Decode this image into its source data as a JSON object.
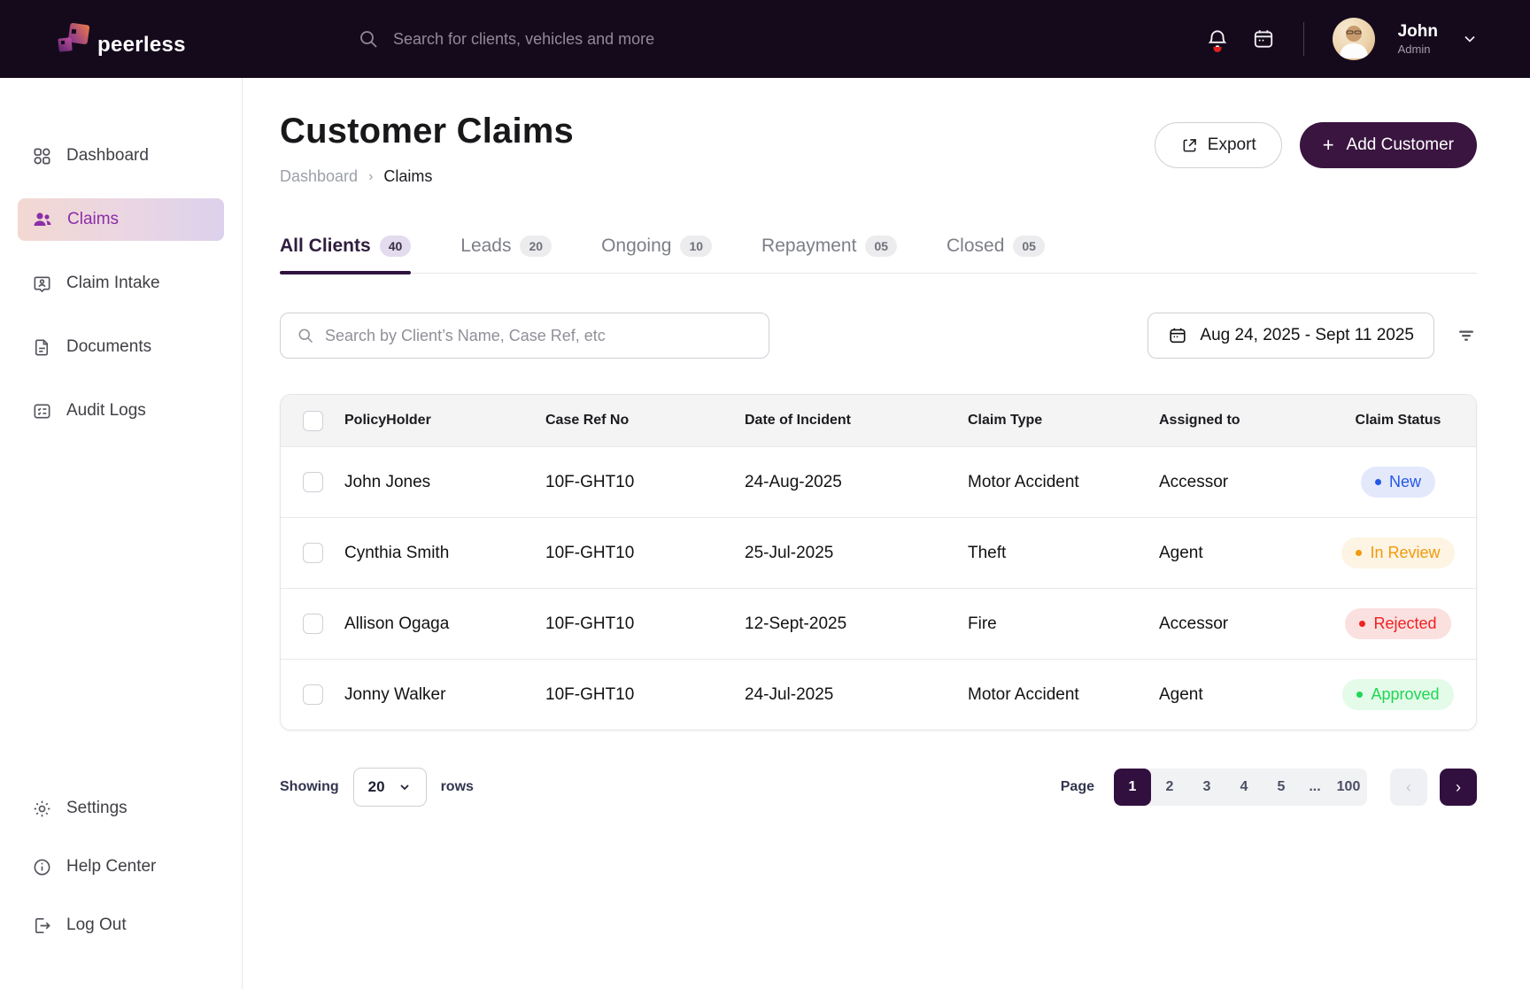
{
  "topbar": {
    "brand": "peerless",
    "search_placeholder": "Search for clients, vehicles and more",
    "user": {
      "name": "John",
      "role": "Admin"
    }
  },
  "sidebar": {
    "items": [
      {
        "label": "Dashboard"
      },
      {
        "label": "Claims"
      },
      {
        "label": "Claim Intake"
      },
      {
        "label": "Documents"
      },
      {
        "label": "Audit Logs"
      }
    ],
    "footer_items": [
      {
        "label": "Settings"
      },
      {
        "label": "Help Center"
      },
      {
        "label": "Log Out"
      }
    ]
  },
  "header": {
    "title": "Customer Claims",
    "breadcrumb": {
      "parent": "Dashboard",
      "separator": "›",
      "current": "Claims"
    },
    "export_label": "Export",
    "add_customer_icon": "+",
    "add_customer_label": "Add Customer"
  },
  "tabs": [
    {
      "label": "All Clients",
      "count": "40"
    },
    {
      "label": "Leads",
      "count": "20"
    },
    {
      "label": "Ongoing",
      "count": "10"
    },
    {
      "label": "Repayment",
      "count": "05"
    },
    {
      "label": "Closed",
      "count": "05"
    }
  ],
  "filters": {
    "search_placeholder": "Search by Client’s Name, Case Ref, etc",
    "date_range": "Aug 24, 2025 - Sept 11 2025"
  },
  "table": {
    "columns": [
      "PolicyHolder",
      "Case Ref No",
      "Date of Incident",
      "Claim Type",
      "Assigned to",
      "Claim Status"
    ],
    "rows": [
      {
        "policyholder": "John Jones",
        "case_ref": "10F-GHT10",
        "date": "24-Aug-2025",
        "claim_type": "Motor Accident",
        "assigned_to": "Accessor",
        "status": "New",
        "status_color": "#2457e6",
        "status_bg": "#e3e9fb"
      },
      {
        "policyholder": "Cynthia Smith",
        "case_ref": "10F-GHT10",
        "date": "25-Jul-2025",
        "claim_type": "Theft",
        "assigned_to": "Agent",
        "status": "In Review",
        "status_color": "#f09a0c",
        "status_bg": "#fdf4e3"
      },
      {
        "policyholder": "Allison Ogaga",
        "case_ref": "10F-GHT10",
        "date": "12-Sept-2025",
        "claim_type": "Fire",
        "assigned_to": "Accessor",
        "status": "Rejected",
        "status_color": "#ee2222",
        "status_bg": "#fbe0e0"
      },
      {
        "policyholder": "Jonny Walker",
        "case_ref": "10F-GHT10",
        "date": "24-Jul-2025",
        "claim_type": "Motor Accident",
        "assigned_to": "Agent",
        "status": "Approved",
        "status_color": "#1fd655",
        "status_bg": "#e3fbe8"
      }
    ]
  },
  "footer": {
    "showing_label": "Showing",
    "rows_per_page": "20",
    "rows_label": "rows",
    "page_label": "Page",
    "pages": [
      "1",
      "2",
      "3",
      "4",
      "5",
      "...",
      "100"
    ],
    "active_page": "1",
    "prev_icon": "‹",
    "next_icon": "›"
  },
  "colors": {
    "topbar_bg": "#150a1c",
    "accent_dark_purple": "#31103f",
    "active_nav_purple": "#8a2fa8",
    "active_nav_gradient_left": "#f3d8d2",
    "active_nav_gradient_right": "#dcd1ec"
  }
}
